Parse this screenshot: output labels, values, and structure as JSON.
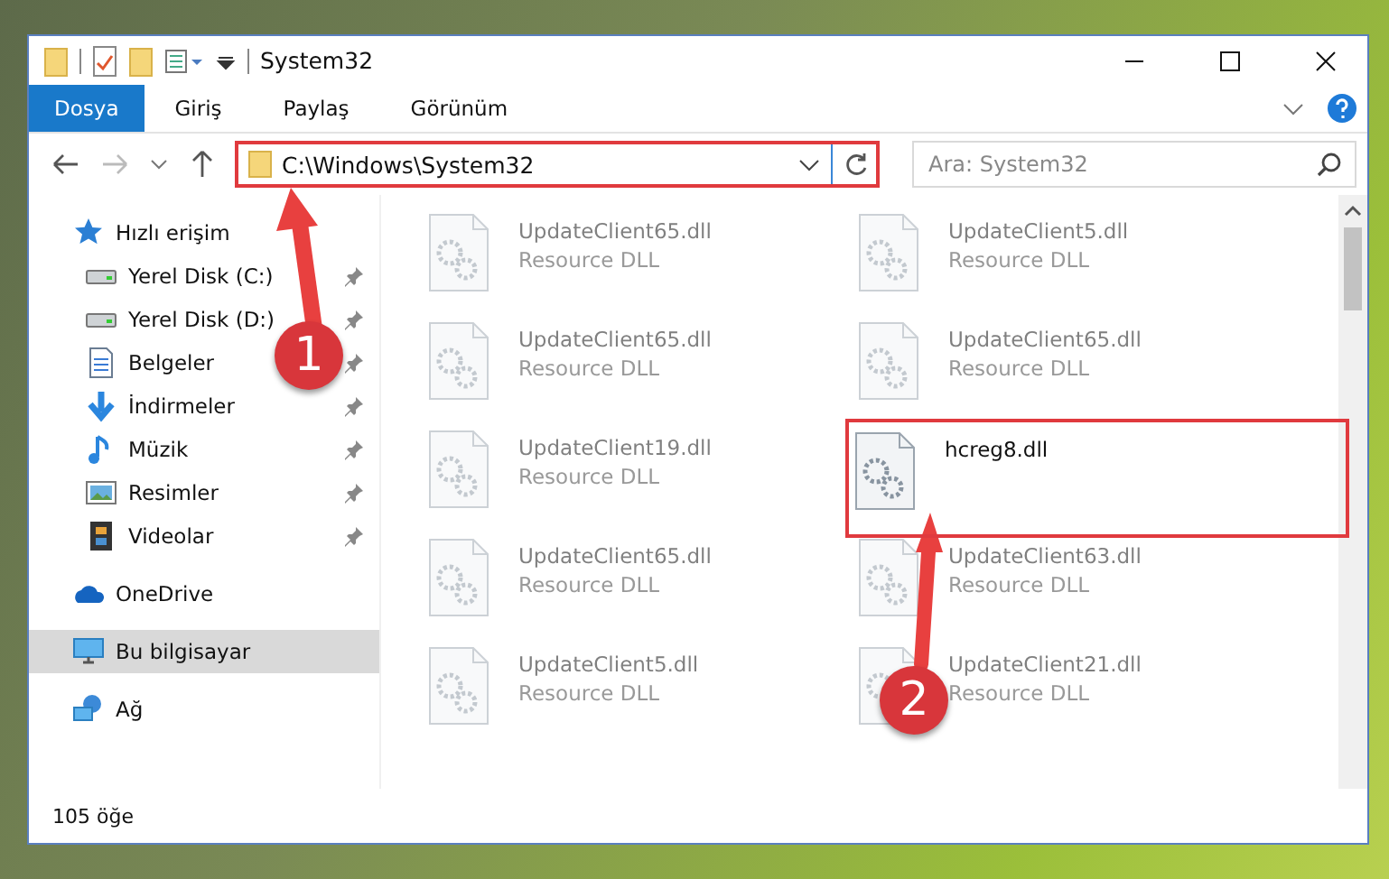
{
  "window": {
    "title": "System32"
  },
  "ribbon_tabs": [
    {
      "label": "Dosya",
      "selected": true
    },
    {
      "label": "Giriş",
      "selected": false
    },
    {
      "label": "Paylaş",
      "selected": false
    },
    {
      "label": "Görünüm",
      "selected": false
    }
  ],
  "address_bar": {
    "path": "C:\\Windows\\System32",
    "highlighted": true
  },
  "search": {
    "placeholder": "Ara: System32"
  },
  "sidebar": {
    "items": [
      {
        "label": "Hızlı erişim",
        "kind": "star",
        "selected": false,
        "children": [
          {
            "label": "Yerel Disk (C:)",
            "kind": "drive",
            "pinned": true,
            "selected": false
          },
          {
            "label": "Yerel Disk (D:)",
            "kind": "drive",
            "pinned": true,
            "selected": false
          },
          {
            "label": "Belgeler",
            "kind": "document",
            "pinned": true,
            "selected": false
          },
          {
            "label": "İndirmeler",
            "kind": "download",
            "pinned": true,
            "selected": false
          },
          {
            "label": "Müzik",
            "kind": "music",
            "pinned": true,
            "selected": false
          },
          {
            "label": "Resimler",
            "kind": "picture",
            "pinned": true,
            "selected": false
          },
          {
            "label": "Videolar",
            "kind": "video",
            "pinned": true,
            "selected": false
          }
        ]
      },
      {
        "label": "OneDrive",
        "kind": "cloud",
        "selected": false
      },
      {
        "label": "Bu bilgisayar",
        "kind": "computer",
        "selected": true
      },
      {
        "label": "Ağ",
        "kind": "network",
        "selected": false
      }
    ]
  },
  "files": [
    {
      "name": "UpdateClient65.dll",
      "type": "Resource DLL",
      "dimmed": true,
      "highlighted": false
    },
    {
      "name": "UpdateClient5.dll",
      "type": "Resource DLL",
      "dimmed": true,
      "highlighted": false
    },
    {
      "name": "UpdateClient65.dll",
      "type": "Resource DLL",
      "dimmed": true,
      "highlighted": false
    },
    {
      "name": "UpdateClient65.dll",
      "type": "Resource DLL",
      "dimmed": true,
      "highlighted": false
    },
    {
      "name": "UpdateClient19.dll",
      "type": "Resource DLL",
      "dimmed": true,
      "highlighted": false
    },
    {
      "name": "hcreg8.dll",
      "dimmed": false,
      "highlighted": true
    },
    {
      "name": "UpdateClient65.dll",
      "type": "Resource DLL",
      "dimmed": true,
      "highlighted": false
    },
    {
      "name": "UpdateClient63.dll",
      "type": "Resource DLL",
      "dimmed": true,
      "highlighted": false
    },
    {
      "name": "UpdateClient5.dll",
      "type": "Resource DLL",
      "dimmed": true,
      "highlighted": false
    },
    {
      "name": "UpdateClient21.dll",
      "type": "Resource DLL",
      "dimmed": true,
      "highlighted": false
    }
  ],
  "status_bar": {
    "item_count": "105 öğe"
  },
  "annotations": [
    {
      "label": "1"
    },
    {
      "label": "2"
    }
  ]
}
